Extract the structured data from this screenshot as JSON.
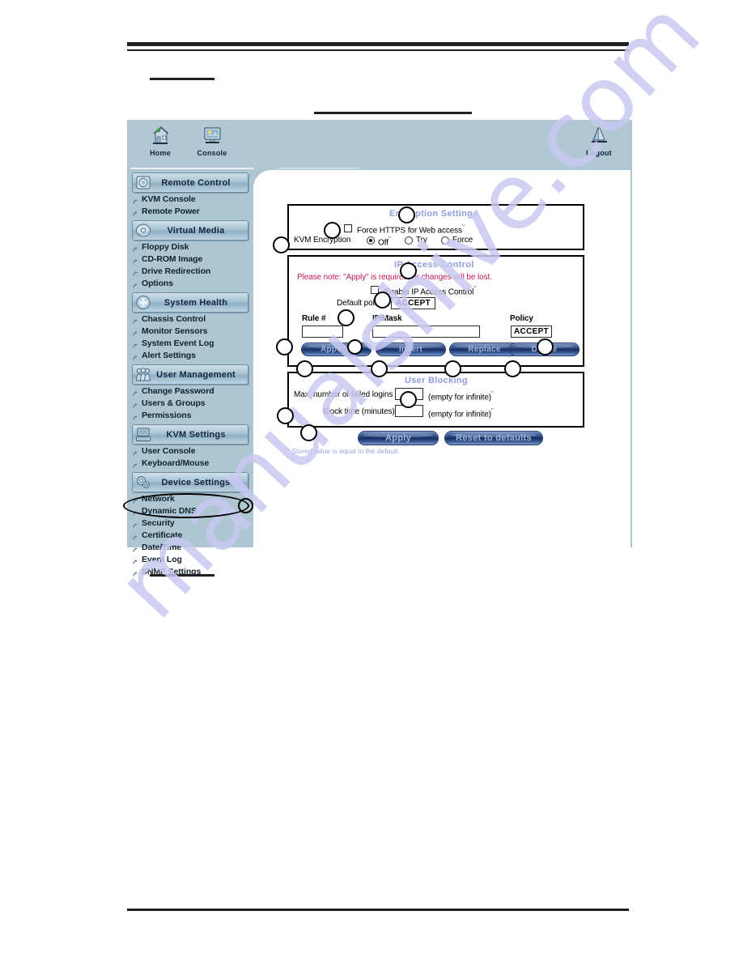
{
  "app": {
    "header": {
      "items": [
        {
          "id": "home",
          "label": "Home",
          "icon": "home-icon"
        },
        {
          "id": "console",
          "label": "Console",
          "icon": "monitor-icon"
        },
        {
          "id": "logout",
          "label": "Logout",
          "icon": "logout-icon"
        }
      ]
    },
    "sidebar": {
      "sections": [
        {
          "id": "remote-control",
          "label": "Remote Control",
          "icon": "camera-icon",
          "items": [
            "KVM Console",
            "Remote Power"
          ]
        },
        {
          "id": "virtual-media",
          "label": "Virtual Media",
          "icon": "disc-icon",
          "items": [
            "Floppy Disk",
            "CD-ROM Image",
            "Drive Redirection",
            "Options"
          ]
        },
        {
          "id": "system-health",
          "label": "System Health",
          "icon": "heart-icon",
          "items": [
            "Chassis Control",
            "Monitor Sensors",
            "System Event Log",
            "Alert Settings"
          ]
        },
        {
          "id": "user-management",
          "label": "User Management",
          "icon": "users-icon",
          "items": [
            "Change Password",
            "Users & Groups",
            "Permissions"
          ]
        },
        {
          "id": "kvm-settings",
          "label": "KVM Settings",
          "icon": "keyboard-icon",
          "items": [
            "User Console",
            "Keyboard/Mouse"
          ]
        },
        {
          "id": "device-settings",
          "label": "Device Settings",
          "icon": "gears-icon",
          "items": [
            "Network",
            "Dynamic DNS",
            "Security",
            "Certificate",
            "Date/Time",
            "Event Log",
            "SNMP Settings"
          ]
        }
      ],
      "highlighted_item": "Security"
    },
    "content": {
      "encryption": {
        "title": "Encryption Settings",
        "force_https_label": "Force HTTPS for Web access",
        "force_https_checked": false,
        "kvm_encryption_label": "KVM Encryption",
        "kvm_encryption_options": [
          "Off",
          "Try",
          "Force"
        ],
        "kvm_encryption_selected": "Off"
      },
      "ip_access": {
        "title": "IP Access Control",
        "note": "Please note: \"Apply\" is required, or changes will be lost.",
        "enable_label": "Enable IP Access Control",
        "enable_checked": false,
        "default_policy_label": "Default policy",
        "default_policy_value": "ACCEPT",
        "columns": [
          "Rule #",
          "IP/Mask",
          "Policy"
        ],
        "rule_number_value": "",
        "ip_mask_value": "",
        "policy_value": "ACCEPT",
        "buttons": [
          "Append",
          "Insert",
          "Replace",
          "Delete"
        ]
      },
      "user_blocking": {
        "title": "User Blocking",
        "max_failed_logins_label": "Max. number of failed logins",
        "max_failed_logins_value": "",
        "max_failed_logins_hint": "(empty for infinite)",
        "block_time_label": "Block time (minutes)",
        "block_time_value": "",
        "block_time_hint": "(empty for infinite)"
      },
      "actions": {
        "apply_label": "Apply",
        "reset_label": "Reset to defaults"
      },
      "footnote": "\" Stored value is equal to the default."
    }
  },
  "watermark": {
    "text": "manualshive.com"
  },
  "colors": {
    "window_background": "#aec6d2",
    "panel_title": "#8e9ee0",
    "warning_text": "#c2185b",
    "button_blue": "#28457f",
    "watermark": "#c9c9f2"
  }
}
